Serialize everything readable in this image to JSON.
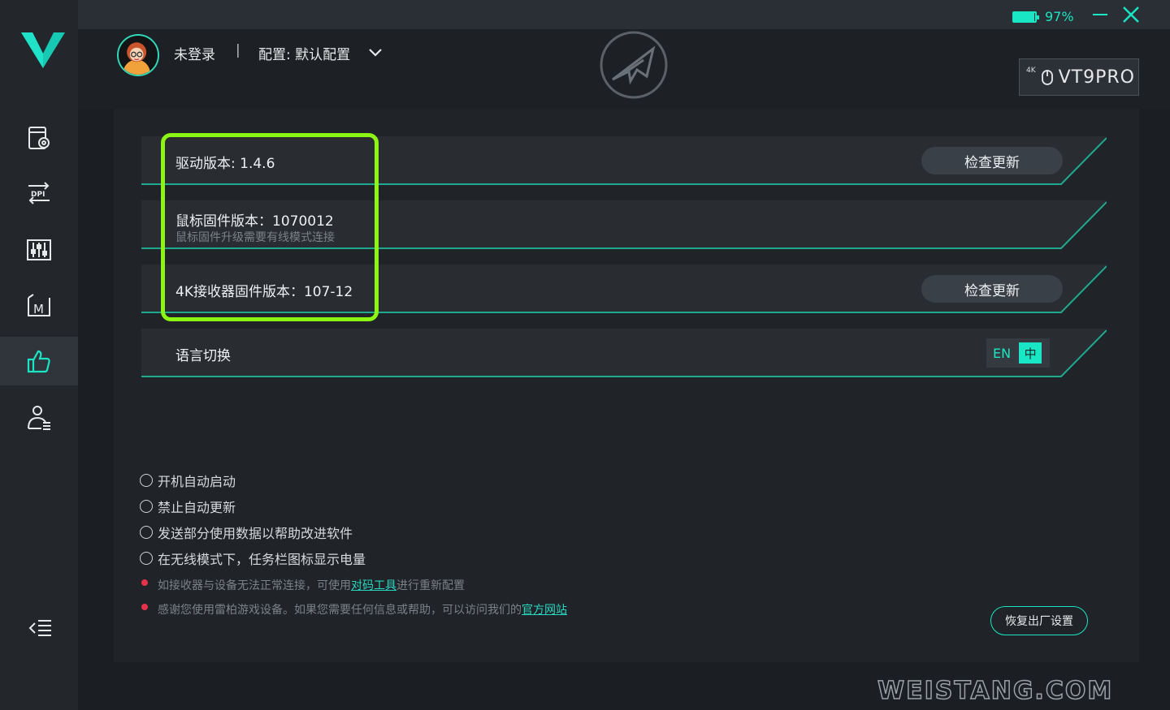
{
  "status": {
    "battery_percent": 97,
    "battery_label": "97%"
  },
  "header": {
    "login_status": "未登录",
    "separator": "|",
    "profile_label": "配置: 默认配置"
  },
  "device": {
    "badge_4k": "4K",
    "name": "VT9PRO"
  },
  "rows": {
    "driver_version": "驱动版本: 1.4.6",
    "mouse_firmware": "鼠标固件版本：1070012",
    "mouse_firmware_hint": "鼠标固件升级需要有线模式连接",
    "receiver_firmware": "4K接收器固件版本：107-12",
    "language_label": "语言切换",
    "check_update": "检查更新"
  },
  "language": {
    "en": "EN",
    "zh": "中"
  },
  "options": [
    "开机自动启动",
    "禁止自动更新",
    "发送部分使用数据以帮助改进软件",
    "在无线模式下，任务栏图标显示电量"
  ],
  "notes": {
    "pairing_prefix": "如接收器与设备无法正常连接，可使用",
    "pairing_link": "对码工具",
    "pairing_suffix": "进行重新配置",
    "thanks_prefix": "感谢您使用雷柏游戏设备。如果您需要任何信息或帮助，可以访问我们的",
    "thanks_link": "官方网站"
  },
  "reset_button": "恢复出厂设置",
  "watermark": "WEISTANG.COM",
  "colors": {
    "accent": "#18e6c4",
    "highlight": "#8cf514",
    "note_dot": "#e8324a"
  }
}
